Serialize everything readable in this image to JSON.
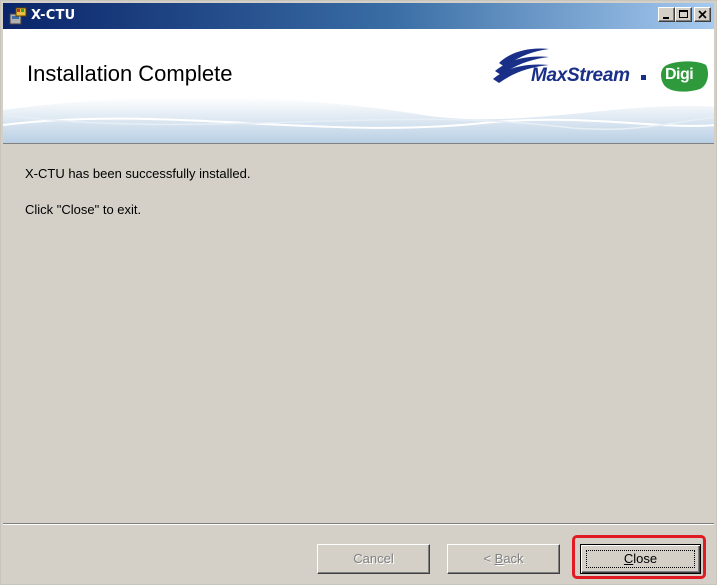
{
  "window": {
    "title": "X-CTU",
    "controls": {
      "minimize_icon": "minimize-icon",
      "maximize_icon": "maximize-icon",
      "close_icon": "close-icon"
    }
  },
  "header": {
    "title": "Installation Complete",
    "logo_text": "MaxStream",
    "badge_text": "Digi"
  },
  "body": {
    "message_1": "X-CTU has been successfully installed.",
    "message_2": "Click \"Close\" to exit."
  },
  "buttons": {
    "cancel": "Cancel",
    "back_mnemonic": "B",
    "back_rest": "ack",
    "close_mnemonic": "C",
    "close_rest": "lose"
  },
  "colors": {
    "highlight": "#e01b24",
    "logo_blue": "#1a2f88",
    "digi_green": "#2e9a3c"
  }
}
